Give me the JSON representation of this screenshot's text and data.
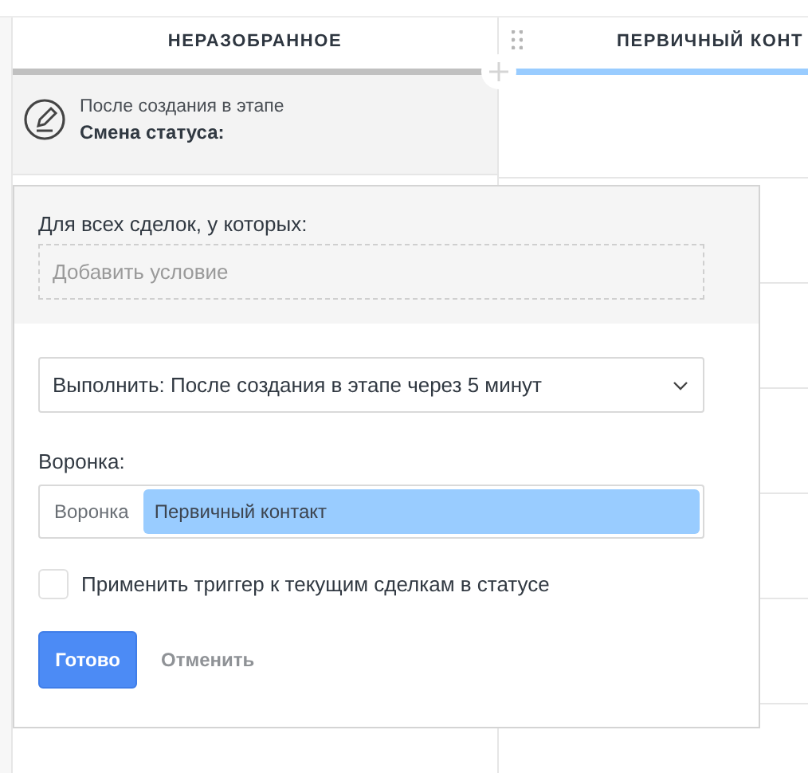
{
  "columns": [
    {
      "title": "НЕРАЗОБРАННОЕ",
      "color": "#c0c0c0"
    },
    {
      "title": "ПЕРВИЧНЫЙ КОНТ",
      "color": "#99ccff"
    }
  ],
  "trigger": {
    "caption": "После создания в этапе",
    "title": "Смена статуса:"
  },
  "popup": {
    "condition_label": "Для всех сделок, у которых:",
    "condition_field": {
      "placeholder": "Добавить условие"
    },
    "execute_select": {
      "value": "Выполнить: После создания в этапе через 5 минут"
    },
    "pipeline_label": "Воронка:",
    "pipeline_field": {
      "prefix": "Воронка",
      "chip": "Первичный контакт"
    },
    "apply_checkbox": {
      "label": "Применить триггер к текущим сделкам в статусе",
      "checked": false
    },
    "buttons": {
      "done": "Готово",
      "cancel": "Отменить"
    }
  }
}
